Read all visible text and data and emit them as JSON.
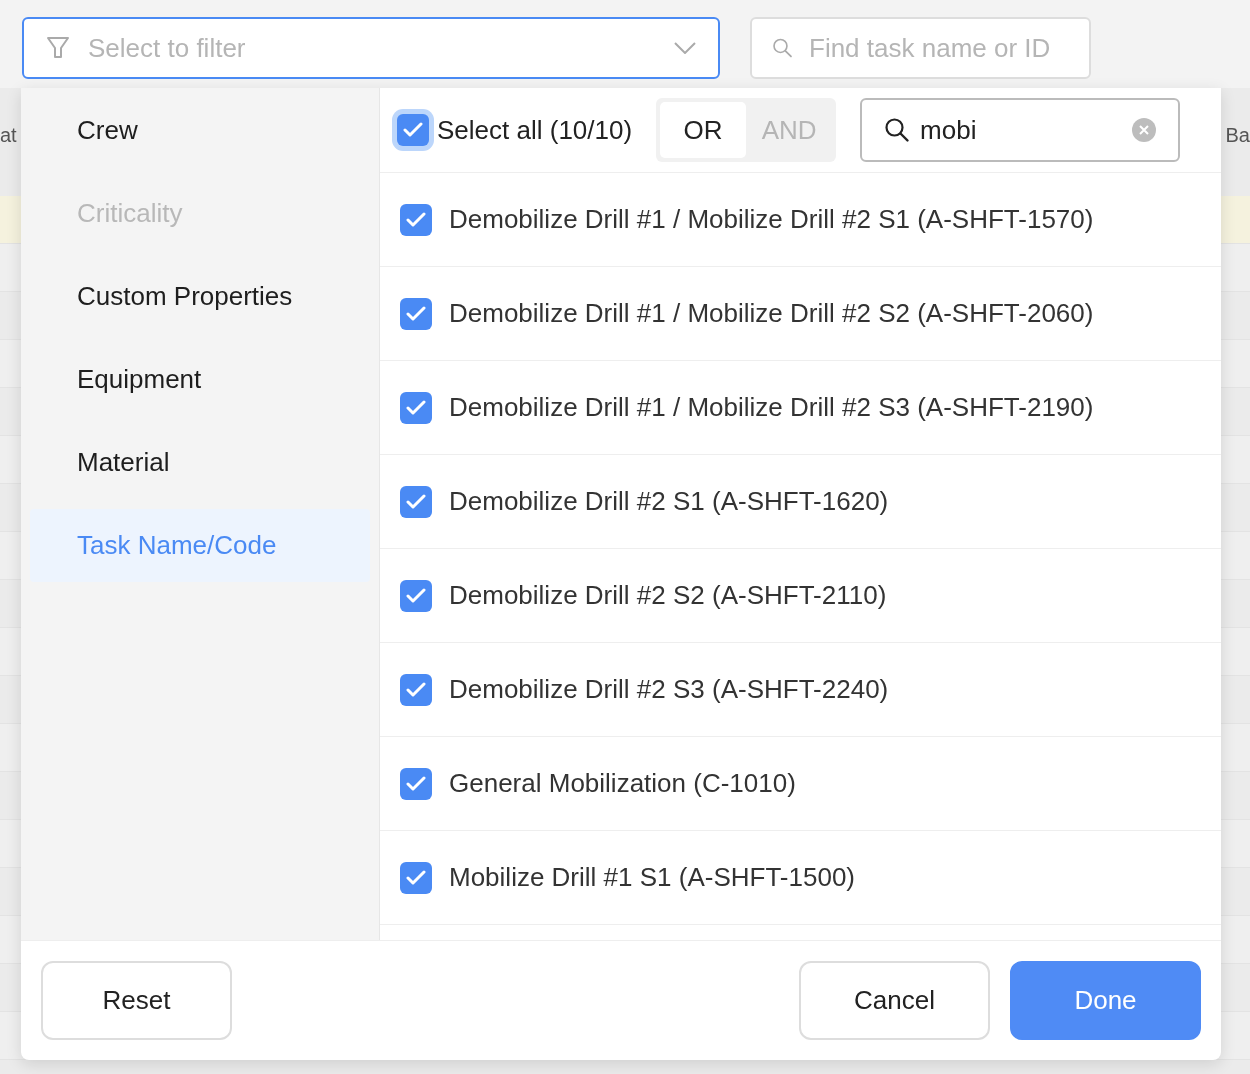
{
  "filter_select": {
    "placeholder": "Select to filter"
  },
  "search": {
    "placeholder": "Find task name or ID"
  },
  "table": {
    "header_left": "at",
    "header_right": "Ba",
    "rows": [
      {
        "highlighted": true
      },
      {
        "highlighted": false
      },
      {
        "highlighted": false
      },
      {
        "highlighted": false
      },
      {
        "highlighted": false
      },
      {
        "highlighted": false
      },
      {
        "highlighted": false
      },
      {
        "highlighted": false
      },
      {
        "highlighted": false
      },
      {
        "highlighted": false
      },
      {
        "highlighted": false
      },
      {
        "highlighted": false
      },
      {
        "highlighted": false
      },
      {
        "highlighted": false
      },
      {
        "highlighted": false
      },
      {
        "highlighted": false
      },
      {
        "highlighted": false
      },
      {
        "highlighted": false
      }
    ]
  },
  "filter_popup": {
    "categories": [
      {
        "label": "Crew",
        "selected": false,
        "disabled": false
      },
      {
        "label": "Criticality",
        "selected": false,
        "disabled": true
      },
      {
        "label": "Custom Properties",
        "selected": false,
        "disabled": false
      },
      {
        "label": "Equipment",
        "selected": false,
        "disabled": false
      },
      {
        "label": "Material",
        "selected": false,
        "disabled": false
      },
      {
        "label": "Task Name/Code",
        "selected": true,
        "disabled": false
      }
    ],
    "select_all": {
      "label": "Select all (10/10)",
      "checked": true
    },
    "logic": [
      {
        "label": "OR",
        "selected": true
      },
      {
        "label": "AND",
        "selected": false
      }
    ],
    "value_search": {
      "value": "mobi"
    },
    "options": [
      {
        "label": "Demobilize Drill #1 / Mobilize Drill #2 S1 (A-SHFT-1570)",
        "checked": true
      },
      {
        "label": "Demobilize Drill #1 / Mobilize Drill #2 S2 (A-SHFT-2060)",
        "checked": true
      },
      {
        "label": "Demobilize Drill #1 / Mobilize Drill #2 S3 (A-SHFT-2190)",
        "checked": true
      },
      {
        "label": "Demobilize Drill #2 S1 (A-SHFT-1620)",
        "checked": true
      },
      {
        "label": "Demobilize Drill #2 S2 (A-SHFT-2110)",
        "checked": true
      },
      {
        "label": "Demobilize Drill #2 S3 (A-SHFT-2240)",
        "checked": true
      },
      {
        "label": "General Mobilization (C-1010)",
        "checked": true
      },
      {
        "label": "Mobilize Drill #1 S1 (A-SHFT-1500)",
        "checked": true
      }
    ],
    "buttons": [
      {
        "label": "Reset",
        "kind": "secondary"
      },
      {
        "label": "Cancel",
        "kind": "secondary"
      },
      {
        "label": "Done",
        "kind": "primary"
      }
    ]
  }
}
